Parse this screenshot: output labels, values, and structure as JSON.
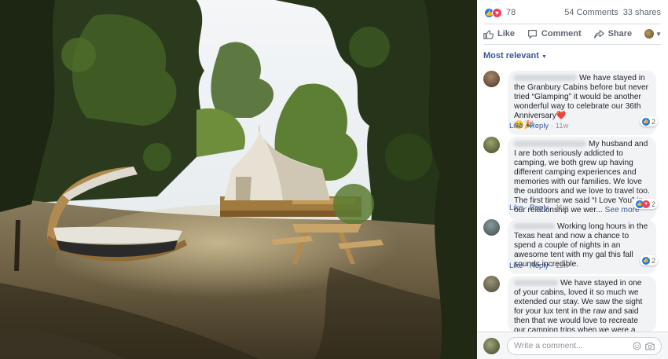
{
  "summary": {
    "reaction_count": "78",
    "comments": "54 Comments",
    "shares": "33 shares",
    "like_color": "#1877f2",
    "love_color": "#f33e58"
  },
  "actions": {
    "like": "Like",
    "comment": "Comment",
    "share": "Share"
  },
  "sort_label": "Most relevant",
  "comments": [
    {
      "text": "We have stayed in the Granbury Cabins before but never tried “Glamping” it would be another wonderful way to celebrate our 36th Anniversary",
      "emoji": "❤️",
      "emoji2": "😊🎉",
      "like": "Like",
      "reply": "Reply",
      "time": "11w",
      "reactions": "2"
    },
    {
      "text": "My husband and I are both seriously addicted to camping, we both grew up having different camping experiences and memories with our families. We love the outdoors and we love to travel too. The first time we said “I Love You” in our relationship we wer...",
      "see_more": "See more",
      "like": "Like",
      "reply": "Reply",
      "time": "11w",
      "reactions": "2"
    },
    {
      "text": "Working long hours in the Texas heat and now a chance to spend a couple of nights in an awesome tent with my gal this fall sounds incredible.",
      "like": "Like",
      "reply": "Reply",
      "time": "11w",
      "reactions": "2"
    },
    {
      "text": "We have stayed in one of your cabins, loved it so much we extended our stay. We saw the sight for your lux tent in the raw and said then that we would love to recreate our camping trips when we were a young couple in love in the"
    }
  ],
  "write_comment": {
    "placeholder": "Write a comment..."
  },
  "icons": {
    "like": "thumbs-up-icon",
    "comment": "speech-bubble-icon",
    "share": "share-arrow-icon",
    "emoji": "smiley-icon",
    "camera": "camera-icon"
  }
}
